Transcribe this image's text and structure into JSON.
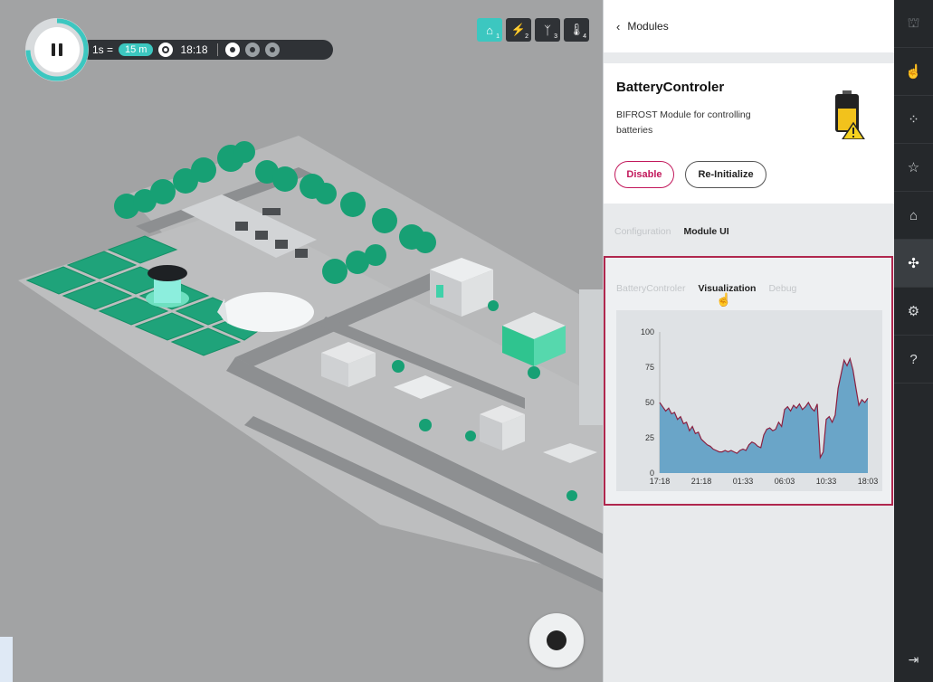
{
  "sim": {
    "rate_label": "1s =",
    "step_label": "15 m",
    "time": "18:18"
  },
  "layers": [
    {
      "icon": "home-icon",
      "glyph": "⌂",
      "index": "1",
      "active": true
    },
    {
      "icon": "lightning-icon",
      "glyph": "⚡",
      "index": "2",
      "active": false
    },
    {
      "icon": "antenna-icon",
      "glyph": "ᛉ",
      "index": "3",
      "active": false
    },
    {
      "icon": "thermometer-icon",
      "glyph": "🌡",
      "index": "4",
      "active": false
    }
  ],
  "panel": {
    "back_label": "Modules",
    "module_title": "BatteryControler",
    "module_desc": "BIFROST Module for controlling batteries",
    "disable_label": "Disable",
    "reinit_label": "Re-Initialize",
    "tabs": [
      "Configuration",
      "Module UI"
    ],
    "sub_tabs": [
      "BatteryControler",
      "Visualization",
      "Debug"
    ]
  },
  "chart_data": {
    "type": "area",
    "x_ticks": [
      "17:18",
      "21:18",
      "01:33",
      "06:03",
      "10:33",
      "18:03"
    ],
    "y_ticks": [
      0,
      25,
      50,
      75,
      100
    ],
    "ylim": [
      0,
      100
    ],
    "values": [
      50,
      47,
      44,
      46,
      42,
      43,
      38,
      40,
      35,
      36,
      30,
      33,
      28,
      29,
      24,
      22,
      20,
      19,
      17,
      16,
      15,
      15,
      16,
      15,
      16,
      15,
      14,
      16,
      17,
      16,
      20,
      22,
      21,
      19,
      18,
      27,
      31,
      32,
      30,
      31,
      36,
      33,
      45,
      47,
      44,
      48,
      46,
      49,
      45,
      47,
      50,
      46,
      44,
      49,
      11,
      15,
      38,
      40,
      36,
      41,
      60,
      70,
      80,
      76,
      81,
      73,
      60,
      48,
      52,
      50,
      53
    ],
    "fill_color": "#6aa5c8",
    "line_color": "#8b2040"
  },
  "nav": [
    {
      "name": "nav-city-icon",
      "glyph": "⛫",
      "faded": true
    },
    {
      "name": "nav-hand-icon",
      "glyph": "☝",
      "faded": false
    },
    {
      "name": "nav-loading-icon",
      "glyph": "⁘",
      "faded": false
    },
    {
      "name": "nav-star-icon",
      "glyph": "☆",
      "faded": false
    },
    {
      "name": "nav-buildings-icon",
      "glyph": "⌂",
      "faded": false
    },
    {
      "name": "nav-modules-icon",
      "glyph": "✣",
      "faded": false,
      "active": true
    },
    {
      "name": "nav-settings-icon",
      "glyph": "⚙",
      "faded": false
    },
    {
      "name": "nav-help-icon",
      "glyph": "?",
      "faded": false
    }
  ],
  "nav_exit_glyph": "⇥",
  "colors": {
    "accent": "#3cc7c0",
    "danger": "#c2185b",
    "grass": "#1fa37a"
  }
}
